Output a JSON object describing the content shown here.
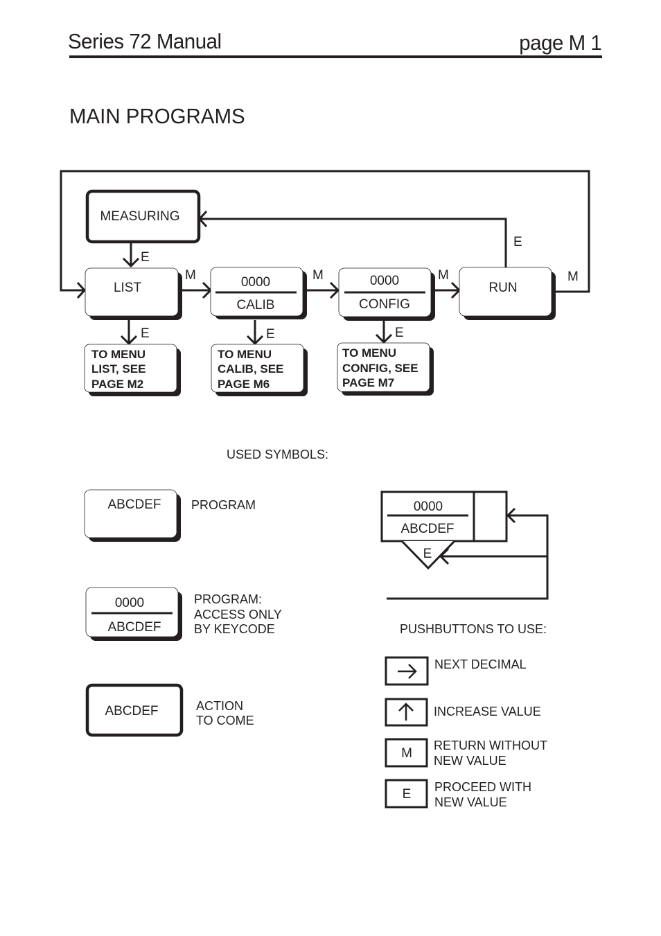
{
  "header": {
    "title": "Series 72 Manual",
    "page": "page  M 1"
  },
  "section_title": "MAIN PROGRAMS",
  "diagram": {
    "nodes": {
      "measuring": "MEASURING",
      "list": "LIST",
      "calib": {
        "code": "0000",
        "name": "CALIB"
      },
      "config": {
        "code": "0000",
        "name": "CONFIG"
      },
      "run": "RUN"
    },
    "submenus": {
      "list": [
        "TO  MENU",
        "LIST, SEE",
        "PAGE M2"
      ],
      "calib": [
        "TO MENU",
        "CALIB, SEE",
        "PAGE M6"
      ],
      "config": [
        "TO MENU",
        "CONFIG, SEE",
        "PAGE M7"
      ]
    },
    "edge_labels": {
      "e": "E",
      "m": "M"
    }
  },
  "symbols": {
    "heading": "USED SYMBOLS:",
    "program": {
      "box": "ABCDEF",
      "desc": "PROGRAM"
    },
    "keycode": {
      "code": "0000",
      "box": "ABCDEF",
      "desc": [
        "PROGRAM:",
        "ACCESS ONLY",
        "BY KEYCODE"
      ]
    },
    "action": {
      "box": "ABCDEF",
      "desc": [
        "ACTION",
        "TO COME"
      ]
    },
    "value_entry": {
      "code": "0000",
      "box": "ABCDEF",
      "key": "E"
    }
  },
  "pushbuttons": {
    "heading": "PUSHBUTTONS TO USE:",
    "items": [
      {
        "icon": "right-arrow-icon",
        "key": "",
        "desc": [
          "NEXT DECIMAL"
        ]
      },
      {
        "icon": "up-arrow-icon",
        "key": "",
        "desc": [
          "INCREASE VALUE"
        ]
      },
      {
        "icon": "",
        "key": "M",
        "desc": [
          "RETURN WITHOUT",
          "NEW VALUE"
        ]
      },
      {
        "icon": "",
        "key": "E",
        "desc": [
          "PROCEED WITH",
          "NEW VALUE"
        ]
      }
    ]
  }
}
